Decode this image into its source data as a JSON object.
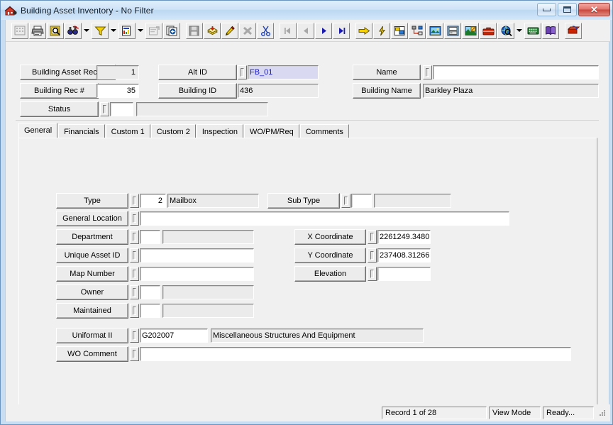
{
  "window": {
    "title": "Building Asset Inventory - No Filter",
    "icon": "house-icon",
    "controls": {
      "minimize": "minimize-button",
      "maximize": "maximize-button",
      "close_label": "✕"
    }
  },
  "toolbar": {
    "items": [
      {
        "name": "grid-icon",
        "enabled": false
      },
      {
        "name": "print-icon",
        "enabled": true
      },
      {
        "name": "print-preview-icon",
        "enabled": true
      },
      {
        "name": "find-icon",
        "enabled": true
      },
      {
        "name": "find-dropdown",
        "enabled": true
      },
      {
        "name": "filter-funnel-icon",
        "enabled": true
      },
      {
        "name": "filter-dropdown",
        "enabled": true
      },
      {
        "name": "report-icon",
        "enabled": true
      },
      {
        "name": "report-dropdown",
        "enabled": true
      },
      {
        "name": "properties-icon",
        "enabled": false
      },
      {
        "name": "copy-record-icon",
        "enabled": true
      },
      {
        "name": "save-icon",
        "enabled": false
      },
      {
        "name": "add-record-icon",
        "enabled": true
      },
      {
        "name": "edit-record-icon",
        "enabled": true
      },
      {
        "name": "delete-record-icon",
        "enabled": false
      },
      {
        "name": "cut-icon",
        "enabled": true
      },
      {
        "name": "first-record-icon",
        "enabled": false
      },
      {
        "name": "previous-record-icon",
        "enabled": false
      },
      {
        "name": "next-record-icon",
        "enabled": true
      },
      {
        "name": "last-record-icon",
        "enabled": true
      },
      {
        "name": "goto-icon",
        "enabled": true
      },
      {
        "name": "lightning-icon",
        "enabled": true
      },
      {
        "name": "layout-icon",
        "enabled": true
      },
      {
        "name": "tree-icon",
        "enabled": true
      },
      {
        "name": "image-icon",
        "enabled": true
      },
      {
        "name": "fax-icon",
        "enabled": true
      },
      {
        "name": "map-icon",
        "enabled": true
      },
      {
        "name": "toolbox-icon",
        "enabled": true
      },
      {
        "name": "globe-search-icon",
        "enabled": true
      },
      {
        "name": "globe-dropdown",
        "enabled": true
      },
      {
        "name": "keyboard-icon",
        "enabled": true
      },
      {
        "name": "help-book-icon",
        "enabled": true
      },
      {
        "name": "exit-icon",
        "enabled": true
      }
    ]
  },
  "header": {
    "building_asset_rec": {
      "label": "Building Asset Rec #",
      "value": "1"
    },
    "building_rec": {
      "label": "Building Rec #",
      "value": "35"
    },
    "status": {
      "label": "Status",
      "code": "",
      "description": ""
    },
    "alt_id": {
      "label": "Alt ID",
      "value": "FB_01"
    },
    "building_id": {
      "label": "Building ID",
      "value": "436"
    },
    "name": {
      "label": "Name",
      "value": ""
    },
    "building_name": {
      "label": "Building Name",
      "value": "Barkley Plaza"
    }
  },
  "tabs": [
    {
      "label": "General",
      "active": true
    },
    {
      "label": "Financials",
      "active": false
    },
    {
      "label": "Custom 1",
      "active": false
    },
    {
      "label": "Custom 2",
      "active": false
    },
    {
      "label": "Inspection",
      "active": false
    },
    {
      "label": "WO/PM/Req",
      "active": false
    },
    {
      "label": "Comments",
      "active": false
    }
  ],
  "general": {
    "type": {
      "label": "Type",
      "code": "2",
      "description": "Mailbox"
    },
    "sub_type": {
      "label": "Sub Type",
      "code": "",
      "description": ""
    },
    "general_location": {
      "label": "General Location",
      "value": ""
    },
    "department": {
      "label": "Department",
      "code": "",
      "description": ""
    },
    "unique_asset_id": {
      "label": "Unique Asset ID",
      "value": ""
    },
    "map_number": {
      "label": "Map Number",
      "value": ""
    },
    "owner": {
      "label": "Owner",
      "code": "",
      "description": ""
    },
    "maintained": {
      "label": "Maintained",
      "code": "",
      "description": ""
    },
    "x_coordinate": {
      "label": "X Coordinate",
      "value": "2261249.3480"
    },
    "y_coordinate": {
      "label": "Y Coordinate",
      "value": "237408.31266"
    },
    "elevation": {
      "label": "Elevation",
      "value": ""
    },
    "uniformat_ii": {
      "label": "Uniformat II",
      "code": "G202007",
      "description": "Miscellaneous Structures And Equipment"
    },
    "wo_comment": {
      "label": "WO Comment",
      "value": ""
    }
  },
  "statusbar": {
    "record": "Record 1 of 28",
    "mode": "View Mode",
    "state": "Ready..."
  },
  "colors": {
    "frame": "#c8ddf2",
    "client": "#f0f0f0",
    "field_bg": "#ffffff",
    "field_readonly": "#ebebeb",
    "selected_text": "#1a1ac8",
    "selected_bg": "#d9d9f2",
    "accent_yellow": "#f5d000",
    "accent_red": "#cc2200"
  }
}
